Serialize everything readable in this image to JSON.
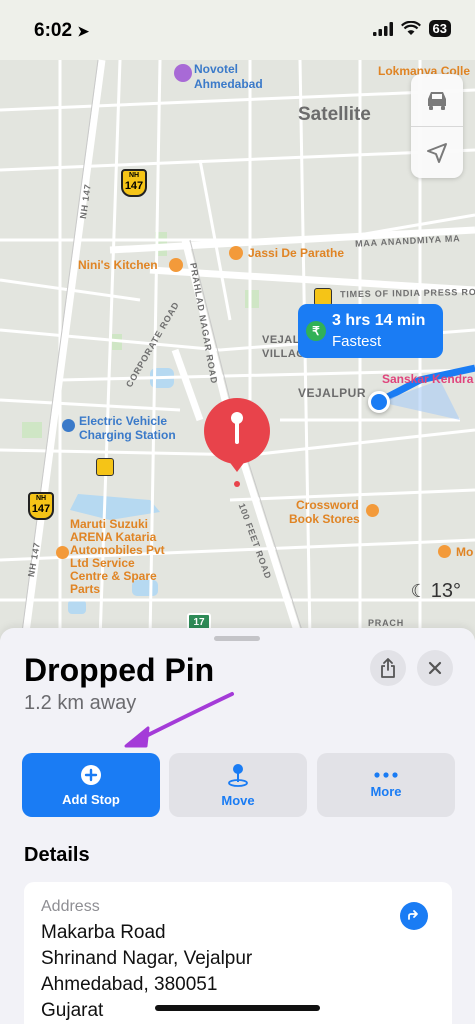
{
  "status_bar": {
    "time": "6:02",
    "battery": "63"
  },
  "map": {
    "labels": {
      "novotel": "Novotel",
      "novotel2": "Ahmedabad",
      "satellite": "Satellite",
      "lokmanya": "Lokmanya Colle",
      "nh147_top": "147",
      "nh147_mid": "147",
      "nh_small": "NH",
      "nh147_road": "NH 147",
      "maa_road": "MAA ANANDMIYA MA",
      "jassi": "Jassi De Parathe",
      "ninis": "Nini's Kitchen",
      "times_road": "TIMES OF INDIA PRESS ROAD",
      "prahlad": "PRAHLAD NAGAR ROAD",
      "corporate": "CORPORATE ROAD",
      "vejal_village": "VEJAL",
      "village": "VILLAGE",
      "vejalpur": "VEJALPUR",
      "sanskar": "Sanskar Kendra",
      "ev1": "Electric Vehicle",
      "ev2": "Charging Station",
      "crossword1": "Crossword",
      "crossword2": "Book Stores",
      "maruti": [
        "Maruti Suzuki",
        "ARENA Kataria",
        "Automobiles Pvt",
        "Ltd Service",
        "Centre & Spare",
        "Parts"
      ],
      "feet_road": "100 FEET ROAD",
      "nh147_left": "NH 147",
      "prach": "PRACH",
      "mo": "Mo",
      "seventeen": "17"
    },
    "route_badge": {
      "time": "3 hrs 14 min",
      "sub": "Fastest",
      "icon": "₹"
    },
    "weather": "13°",
    "controls": [
      "car-icon",
      "location-arrow-icon"
    ]
  },
  "sheet": {
    "title": "Dropped Pin",
    "subtitle": "1.2 km away",
    "actions": [
      {
        "label": "Add Stop",
        "icon": "plus-circle-icon"
      },
      {
        "label": "Move",
        "icon": "pin-move-icon"
      },
      {
        "label": "More",
        "icon": "ellipsis-icon"
      }
    ],
    "details_heading": "Details",
    "address": {
      "label": "Address",
      "lines": [
        "Makarba Road",
        "Shrinand Nagar, Vejalpur",
        "Ahmedabad, 380051",
        "Gujarat"
      ]
    }
  },
  "colors": {
    "accent": "#1a7cf4",
    "pin": "#e8434b",
    "arrow": "#a43bd8",
    "route_green": "#31b157"
  }
}
